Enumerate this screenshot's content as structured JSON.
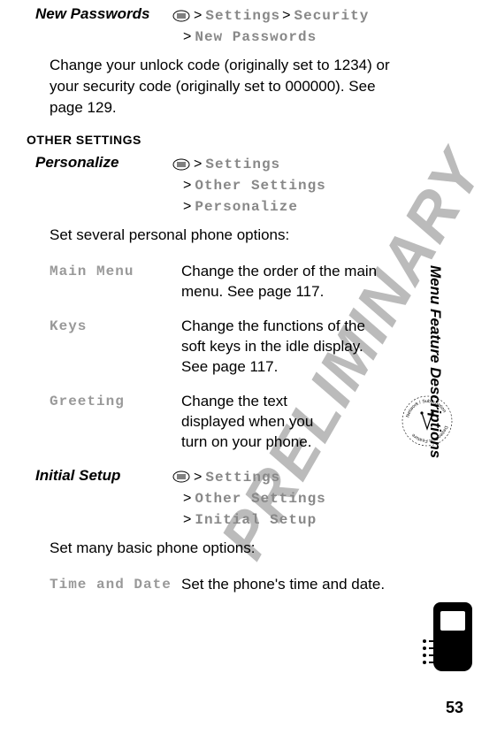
{
  "watermark": "PRELIMINARY",
  "side_title": "Menu Feature Descriptions",
  "page_number": "53",
  "section_label": "OTHER SETTINGS",
  "features": {
    "new_passwords": {
      "title": "New Passwords",
      "path1": "Settings",
      "path2": "Security",
      "path3": "New Passwords",
      "desc": "Change your unlock code (originally set to 1234) or your security code (originally set to 000000). See page 129."
    },
    "personalize": {
      "title": "Personalize",
      "path1": "Settings",
      "path2": "Other Settings",
      "path3": "Personalize",
      "intro": "Set several personal phone options:",
      "items": {
        "main_menu": {
          "label": "Main Menu",
          "desc": "Change the order of the main menu. See page 117."
        },
        "keys": {
          "label": "Keys",
          "desc": "Change the functions of the soft keys in the idle display. See page 117."
        },
        "greeting": {
          "label": "Greeting",
          "desc": "Change the text displayed when you turn on your phone."
        }
      }
    },
    "initial_setup": {
      "title": "Initial Setup",
      "path1": "Settings",
      "path2": "Other Settings",
      "path3": "Initial Setup",
      "intro": "Set many basic phone options:",
      "items": {
        "time_date": {
          "label": "Time and Date",
          "desc": "Set the phone's time and date."
        }
      }
    }
  }
}
